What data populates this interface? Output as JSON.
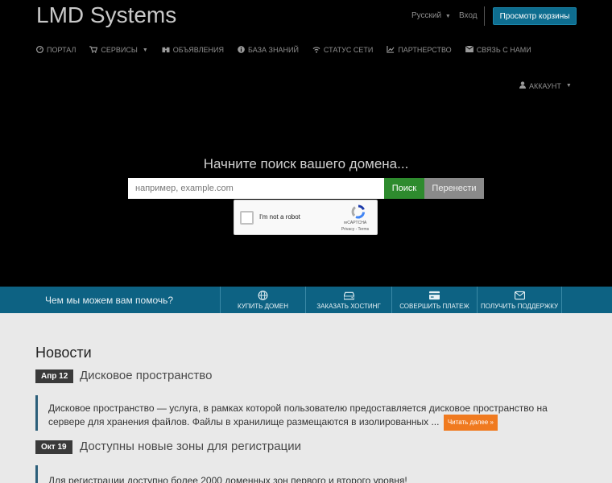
{
  "header": {
    "logo": "LMD Systems",
    "language": "Русский",
    "login": "Вход",
    "cart_button": "Просмотр корзины"
  },
  "nav": {
    "items": [
      {
        "label": "Портал",
        "icon": "speedometer-icon"
      },
      {
        "label": "Сервисы",
        "icon": "cart-icon"
      },
      {
        "label": "Объявления",
        "icon": "binoculars-icon"
      },
      {
        "label": "База знаний",
        "icon": "info-icon"
      },
      {
        "label": "Статус сети",
        "icon": "wifi-icon"
      },
      {
        "label": "Партнерство",
        "icon": "chart-icon"
      },
      {
        "label": "Связь с нами",
        "icon": "envelope-icon"
      }
    ],
    "account": "Аккаунт"
  },
  "hero": {
    "title": "Начните поиск вашего домена...",
    "search_placeholder": "например, example.com",
    "search_button": "Поиск",
    "transfer_button": "Перенести"
  },
  "recaptcha": {
    "label": "I'm not a robot",
    "brand": "reCAPTCHA",
    "links": "Privacy - Terms"
  },
  "help": {
    "text": "Чем мы можем вам помочь?",
    "buttons": [
      {
        "label": "Купить домен",
        "icon": "globe-icon"
      },
      {
        "label": "Заказать хостинг",
        "icon": "server-icon"
      },
      {
        "label": "Совершить платеж",
        "icon": "credit-card-icon"
      },
      {
        "label": "Получить поддержку",
        "icon": "envelope-icon"
      }
    ]
  },
  "news": {
    "title": "Новости",
    "items": [
      {
        "date": "Апр 12",
        "headline": "Дисковое пространство",
        "line1": "Дисковое пространство — услуга, в рамках которой пользователю предоставляется дисковое пространство на",
        "line2": "сервере для хранения файлов. Файлы в хранилище размещаются в изолированных ...",
        "read_more": "Читать далее »"
      },
      {
        "date": "Окт 19",
        "headline": "Доступны новые зоны для регистрации",
        "line1": "Для регистрации доступно более 2000 доменных зон первого и второго уровня!"
      }
    ]
  },
  "colors": {
    "brand_blue": "#0d6283",
    "search_green": "#2e8b2e",
    "read_more_orange": "#f07a1f"
  }
}
